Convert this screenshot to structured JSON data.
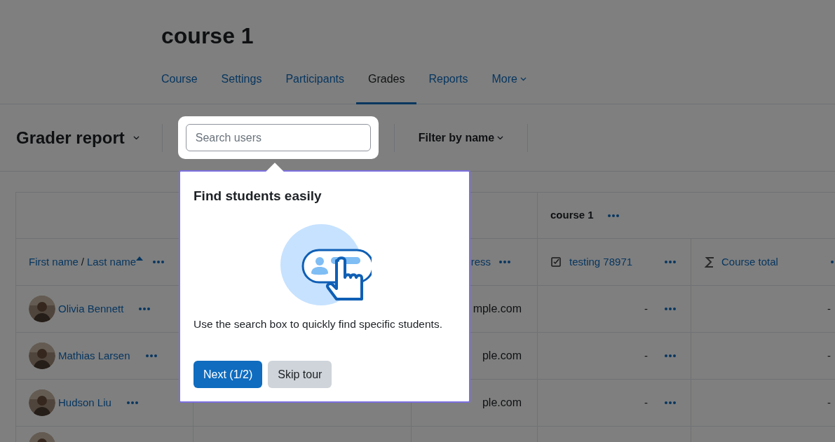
{
  "course_title": "course 1",
  "nav_tabs": [
    {
      "label": "Course",
      "selected": false,
      "dropdown": false
    },
    {
      "label": "Settings",
      "selected": false,
      "dropdown": false
    },
    {
      "label": "Participants",
      "selected": false,
      "dropdown": false
    },
    {
      "label": "Grades",
      "selected": true,
      "dropdown": false
    },
    {
      "label": "Reports",
      "selected": false,
      "dropdown": false
    },
    {
      "label": "More",
      "selected": false,
      "dropdown": true
    }
  ],
  "report_selector": "Grader report",
  "search": {
    "placeholder": "Search users"
  },
  "filter": "Filter by name",
  "table": {
    "group_header": "course 1",
    "columns": [
      {
        "kind": "name",
        "first": "First name",
        "separator": "/",
        "last": "Last name",
        "sorted_ascending": true
      },
      {
        "kind": "blank"
      },
      {
        "kind": "email",
        "label": "ress"
      },
      {
        "kind": "grade_item",
        "label": "testing 78971"
      },
      {
        "kind": "total",
        "label": "Course total"
      }
    ],
    "rows": [
      {
        "kind": "student",
        "name": "Olivia Bennett",
        "email": "mple.com",
        "grade": "-",
        "total": "-"
      },
      {
        "kind": "student",
        "name": "Mathias Larsen",
        "email": "ple.com",
        "grade": "-",
        "total": "-"
      },
      {
        "kind": "student",
        "name": "Hudson Liu",
        "email": "ple.com",
        "grade": "-",
        "total": "-"
      },
      {
        "kind": "cut"
      }
    ]
  },
  "tour": {
    "title": "Find students easily",
    "body": "Use the search box to quickly find specific students.",
    "buttons": [
      {
        "label": "Next (1/2)",
        "primary": true
      },
      {
        "label": "Skip tour",
        "primary": false
      }
    ]
  }
}
